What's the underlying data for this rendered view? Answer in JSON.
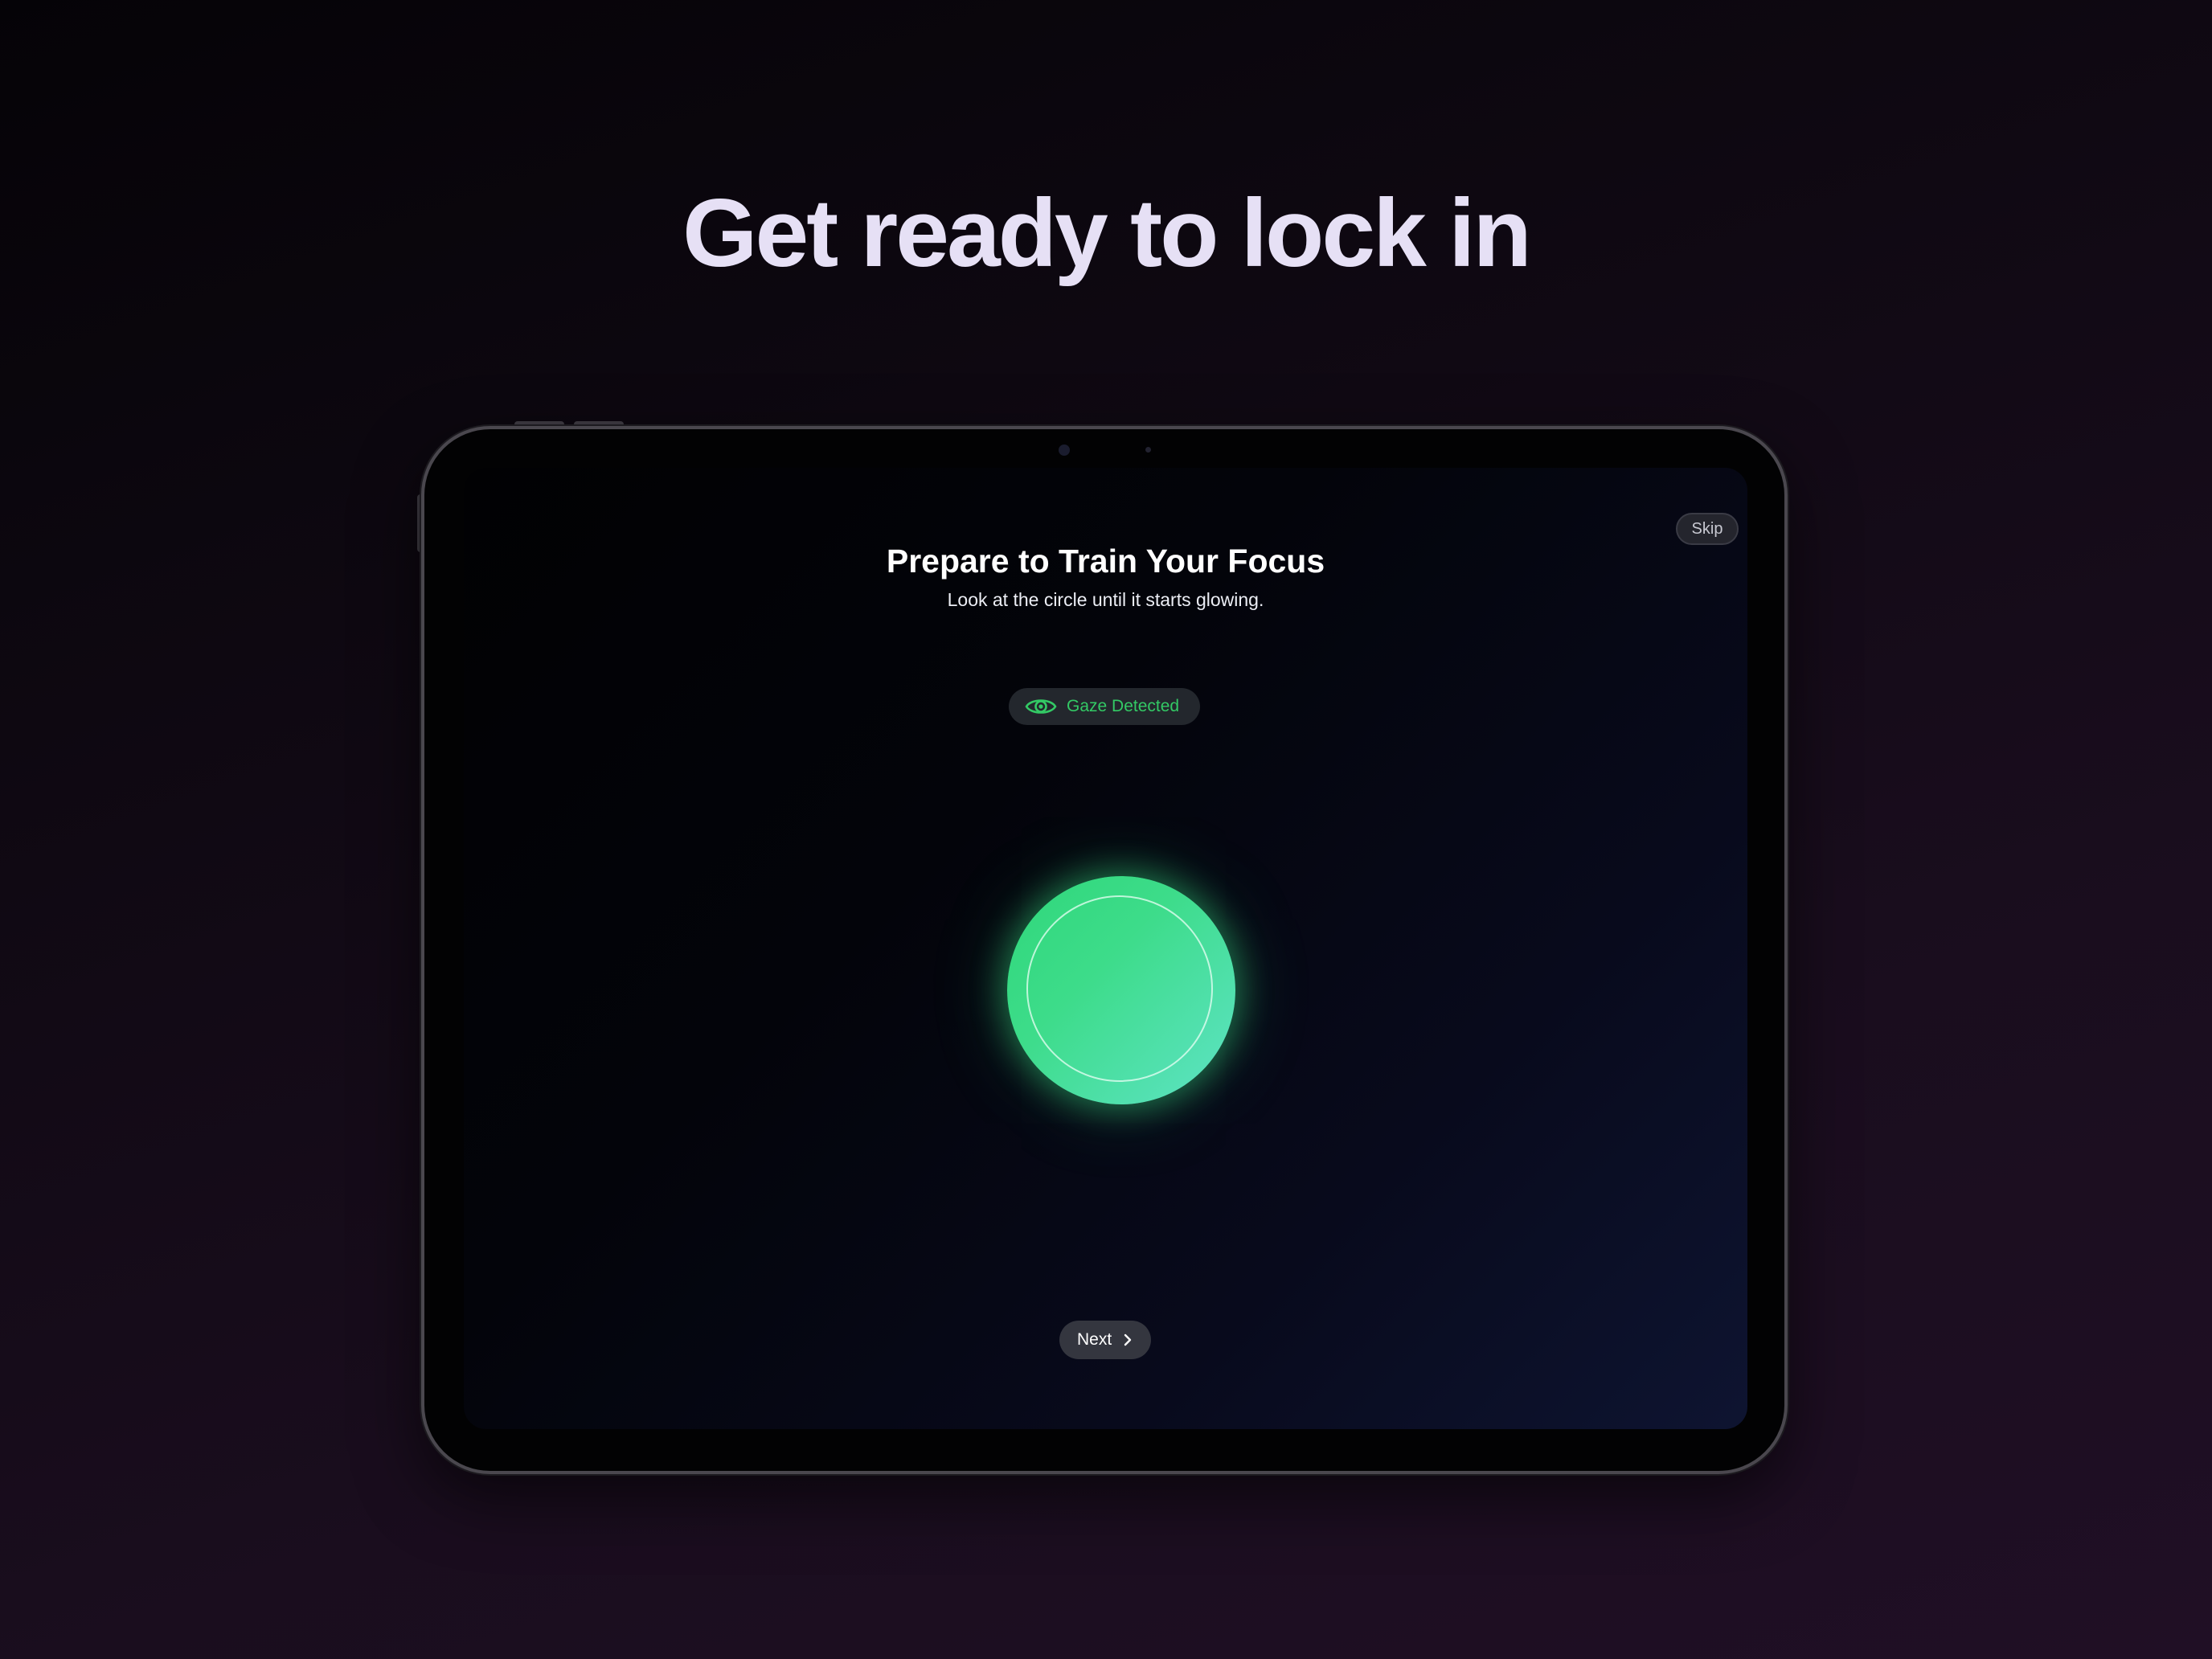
{
  "marketing": {
    "headline": "Get ready to lock in"
  },
  "screen": {
    "skip_label": "Skip",
    "title": "Prepare to Train Your Focus",
    "subtitle": "Look at the circle until it starts glowing.",
    "gaze_status": {
      "icon": "eye-icon",
      "label": "Gaze Detected",
      "color": "#33C965"
    },
    "focus_circle": {
      "state": "glowing",
      "color_start": "#2FD77A",
      "color_end": "#5FE3C6"
    },
    "next_label": "Next",
    "next_icon": "chevron-right-icon"
  },
  "colors": {
    "background": "#1A0D1E",
    "headline": "#E6E0F5",
    "accent_green": "#33C965"
  }
}
